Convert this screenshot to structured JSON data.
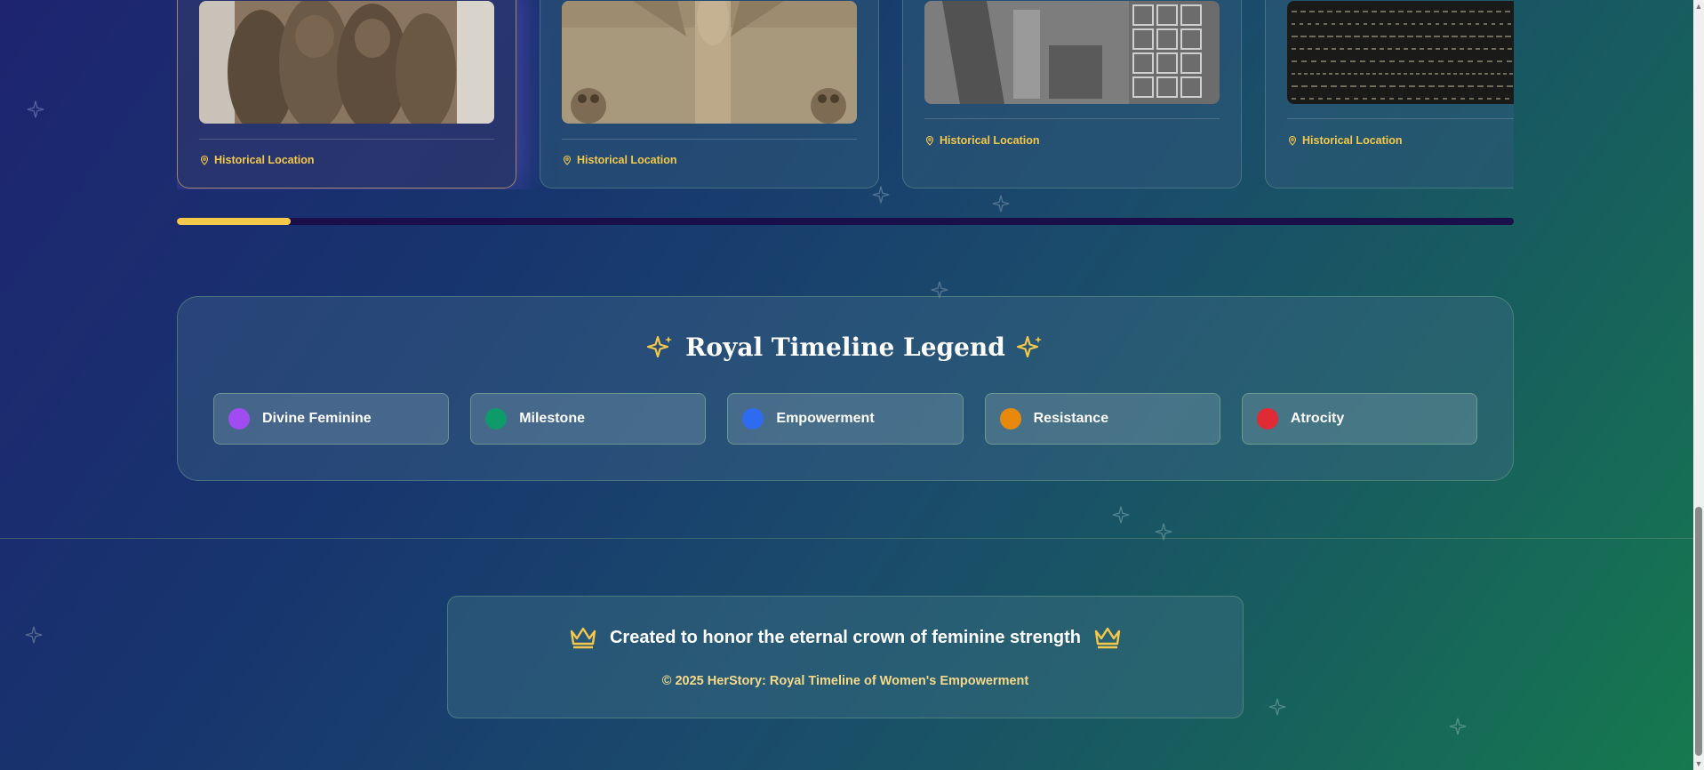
{
  "cards": [
    {
      "location": "Historical Location"
    },
    {
      "location": "Historical Location"
    },
    {
      "location": "Historical Location"
    },
    {
      "location": "Historical Location"
    }
  ],
  "carousel_progress_percent": 8.5,
  "legend": {
    "title": "Royal Timeline Legend",
    "items": [
      {
        "label": "Divine Feminine",
        "color": "#a14cf0"
      },
      {
        "label": "Milestone",
        "color": "#0f9a6a"
      },
      {
        "label": "Empowerment",
        "color": "#2e6bf0"
      },
      {
        "label": "Resistance",
        "color": "#e8890c"
      },
      {
        "label": "Atrocity",
        "color": "#e02a35"
      }
    ]
  },
  "footer": {
    "tagline": "Created to honor the eternal crown of feminine strength",
    "copyright": "© 2025 HerStory: Royal Timeline of Women's Empowerment"
  },
  "colors": {
    "accent_gold": "#f4c84a"
  },
  "icons": [
    "sparkle-icon",
    "map-pin-icon",
    "crown-icon"
  ]
}
